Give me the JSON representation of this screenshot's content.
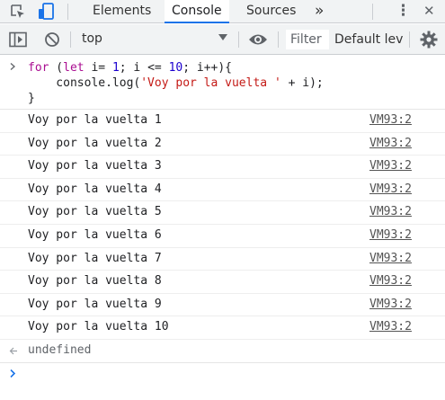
{
  "tabs": [
    {
      "label": "Elements",
      "active": false
    },
    {
      "label": "Console",
      "active": true
    },
    {
      "label": "Sources",
      "active": false
    }
  ],
  "tabbar": {
    "more_tabs": "»",
    "menu": "⋮",
    "close": "✕"
  },
  "toolbar": {
    "context": "top",
    "filter_placeholder": "Filter",
    "levels": "Default lev"
  },
  "command": {
    "lines": [
      "for (let i= 1; i <= 10; i++){",
      "    console.log('Voy por la vuelta ' + i);",
      "}"
    ]
  },
  "logs": [
    {
      "text": "Voy por la vuelta 1",
      "source": "VM93:2"
    },
    {
      "text": "Voy por la vuelta 2",
      "source": "VM93:2"
    },
    {
      "text": "Voy por la vuelta 3",
      "source": "VM93:2"
    },
    {
      "text": "Voy por la vuelta 4",
      "source": "VM93:2"
    },
    {
      "text": "Voy por la vuelta 5",
      "source": "VM93:2"
    },
    {
      "text": "Voy por la vuelta 6",
      "source": "VM93:2"
    },
    {
      "text": "Voy por la vuelta 7",
      "source": "VM93:2"
    },
    {
      "text": "Voy por la vuelta 8",
      "source": "VM93:2"
    },
    {
      "text": "Voy por la vuelta 9",
      "source": "VM93:2"
    },
    {
      "text": "Voy por la vuelta 10",
      "source": "VM93:2"
    }
  ],
  "result": {
    "text": "undefined"
  },
  "colors": {
    "accent": "#1a73e8",
    "keyword": "#aa0d91",
    "number": "#1c00cf",
    "string": "#c41a16"
  }
}
